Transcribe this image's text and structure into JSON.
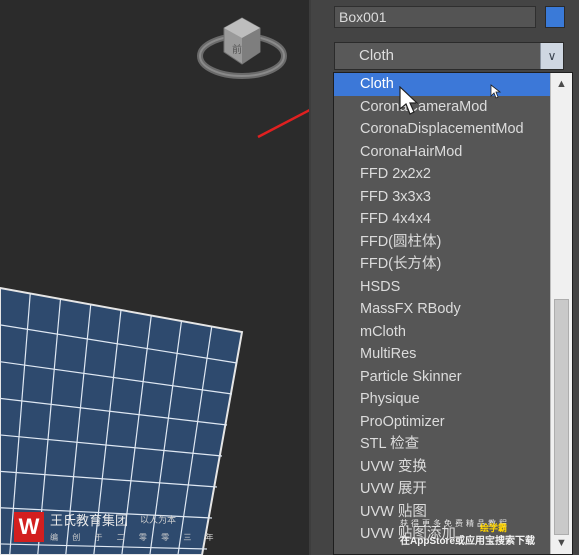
{
  "viewport": {
    "watermark": {
      "logo": "W",
      "title": "王氏教育集团",
      "tagline": "以人为本",
      "subtitle": "编 创 于 二 零 零 三 年"
    }
  },
  "panel": {
    "object_name": "Box001",
    "object_color": "#3a7ad8",
    "modifier_list_value": "Cloth",
    "dropdown_items": [
      "Cloth",
      "CoronaCameraMod",
      "CoronaDisplacementMod",
      "CoronaHairMod",
      "FFD 2x2x2",
      "FFD 3x3x3",
      "FFD 4x4x4",
      "FFD(圆柱体)",
      "FFD(长方体)",
      "HSDS",
      "MassFX RBody",
      "mCloth",
      "MultiRes",
      "Particle Skinner",
      "Physique",
      "ProOptimizer",
      "STL 检查",
      "UVW 变换",
      "UVW 展开",
      "UVW 贴图",
      "UVW 贴图添加"
    ],
    "selected_index": 0,
    "scroll_position_fraction": 0.5
  },
  "corner_watermark": {
    "line1": "获得更多免费精品教程",
    "line2": "在AppStore或应用宝搜索下载",
    "brand": "绘学霸"
  },
  "colors": {
    "selection": "#3c78d8",
    "annotation_arrow": "#e02020",
    "grid_fill": "#2e4a6e"
  }
}
